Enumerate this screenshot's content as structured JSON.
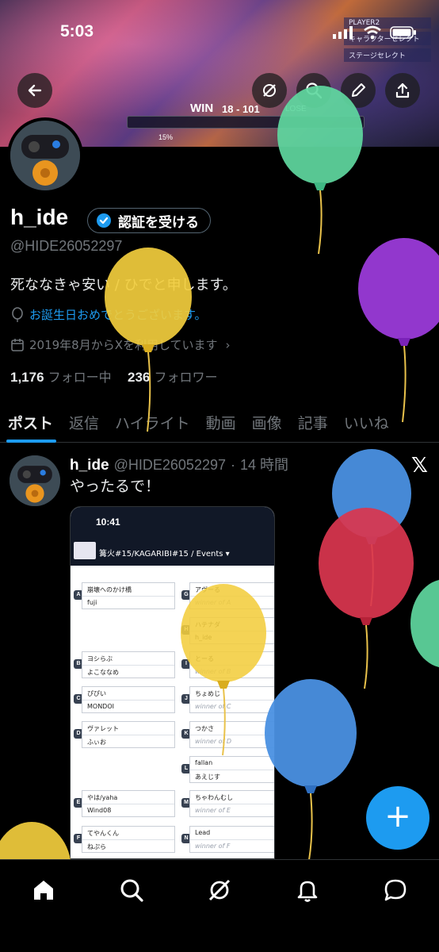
{
  "status_bar": {
    "time": "5:03"
  },
  "banner": {
    "hud_win": "WIN",
    "hud_score": "18 - 101",
    "hud_lose": "LOSE",
    "hud_pct": "15%",
    "side_menu": [
      "PLAYER2",
      "キャラクターセレクト",
      "ステージセレクト"
    ]
  },
  "profile": {
    "name": "h_ide",
    "verify_label": "認証を受ける",
    "handle": "@HIDE26052297",
    "bio": "死ななきゃ安い / ひでと申します。",
    "birthday": "お誕生日おめでとうございます。",
    "joined": "2019年8月からXを利用しています",
    "following_count": "1,176",
    "following_label": "フォロー中",
    "followers_count": "236",
    "followers_label": "フォロワー"
  },
  "tabs": [
    "ポスト",
    "返信",
    "ハイライト",
    "動画",
    "画像",
    "記事",
    "いいね"
  ],
  "post": {
    "name": "h_ide",
    "handle": "@HIDE26052297",
    "separator": "·",
    "time": "14 時間",
    "text": "やったるで！",
    "x_logo": "𝕏"
  },
  "embedded": {
    "time": "10:41",
    "title": "篝火#15/KAGARIBI#15  /  Events ▾",
    "left_bracket": [
      {
        "tag": "A",
        "top": "崩壊へのかけ橋",
        "bottom": "fuji"
      },
      {
        "tag": "B",
        "top": "ヨシらぶ",
        "bottom": "よこななめ"
      },
      {
        "tag": "C",
        "top": "ぴぴい",
        "bottom": "MONDOI"
      },
      {
        "tag": "D",
        "top": "ヴァレット",
        "bottom": "ふぃお"
      },
      {
        "tag": "E",
        "top": "やは/yaha",
        "bottom": "Wind08"
      },
      {
        "tag": "F",
        "top": "てやんくん",
        "bottom": "ねぷら"
      }
    ],
    "right_bracket": [
      {
        "tag": "G",
        "top": "アヴーる",
        "bottom": "winner of A"
      },
      {
        "tag": "H",
        "top": "ハテナダ",
        "bottom": "h_ide"
      },
      {
        "tag": "I",
        "top": "とーる",
        "bottom": "winner of B"
      },
      {
        "tag": "J",
        "top": "ちょめじ",
        "bottom": "winner of C"
      },
      {
        "tag": "K",
        "top": "つかさ",
        "bottom": "winner of D"
      },
      {
        "tag": "L",
        "top": "fallan",
        "bottom": "あえじす"
      },
      {
        "tag": "M",
        "top": "ちゃわんむし",
        "bottom": "winner of E"
      },
      {
        "tag": "N",
        "top": "Lead",
        "bottom": "winner of F"
      }
    ]
  },
  "fab": {
    "label": "+"
  },
  "colors": {
    "accent": "#1d9bf0",
    "background": "#000000",
    "muted": "#71767b"
  }
}
